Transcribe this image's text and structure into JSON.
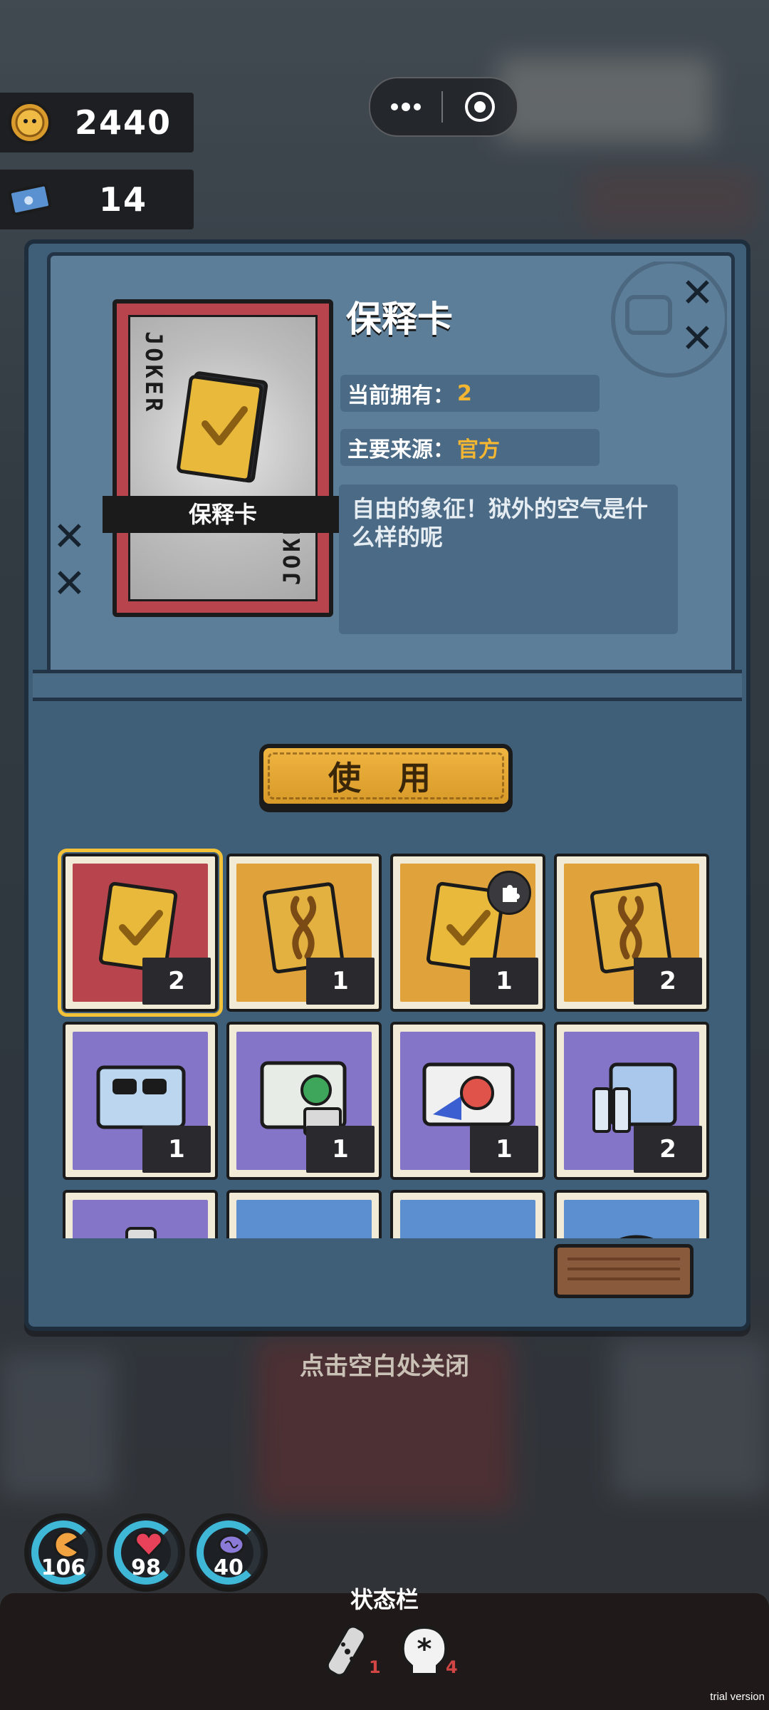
{
  "currency": {
    "coins": "2440",
    "tickets": "14"
  },
  "item_detail": {
    "card_label": "保释卡",
    "card_corner_text": "JOKER",
    "title": "保释卡",
    "owned_label": "当前拥有：",
    "owned_value": "2",
    "source_label": "主要来源：",
    "source_value": "官方",
    "description": "自由的象征！狱外的空气是什么样的呢"
  },
  "use_button": {
    "label": "使 用"
  },
  "inventory": {
    "slots": [
      {
        "count": "2",
        "bg": "#b8454e",
        "icon": "bail-card-icon",
        "selected": true
      },
      {
        "count": "1",
        "bg": "#e0a23a",
        "icon": "ribbon-card-icon"
      },
      {
        "count": "1",
        "bg": "#e0a23a",
        "icon": "bail-card-plus-icon",
        "badge": "puzzle-badge-icon"
      },
      {
        "count": "2",
        "bg": "#e0a23a",
        "icon": "ribbon-card-icon"
      },
      {
        "count": "1",
        "bg": "#8575c8",
        "icon": "sunglasses-box-icon"
      },
      {
        "count": "1",
        "bg": "#8575c8",
        "icon": "virus-box-icon"
      },
      {
        "count": "1",
        "bg": "#8575c8",
        "icon": "monster-box-icon"
      },
      {
        "count": "2",
        "bg": "#8575c8",
        "icon": "medicine-vials-icon"
      },
      {
        "count": "",
        "bg": "#8575c8",
        "icon": "bottle-icon"
      },
      {
        "count": "",
        "bg": "#5b8fd0",
        "icon": "box-icon"
      },
      {
        "count": "",
        "bg": "#5b8fd0",
        "icon": "red-item-icon"
      },
      {
        "count": "",
        "bg": "#5b8fd0",
        "icon": "rock-icon"
      }
    ]
  },
  "close_hint": "点击空白处关闭",
  "stats": {
    "hunger": "106",
    "health": "98",
    "mind": "40"
  },
  "status_bar": {
    "title": "状态栏",
    "bandage_count": "1",
    "skull_count": "4"
  },
  "trial_label": "trial version",
  "colors": {
    "panel": "#3f5e78",
    "accent_gold": "#f2b632",
    "stat_ring": "#3fb8d8"
  }
}
